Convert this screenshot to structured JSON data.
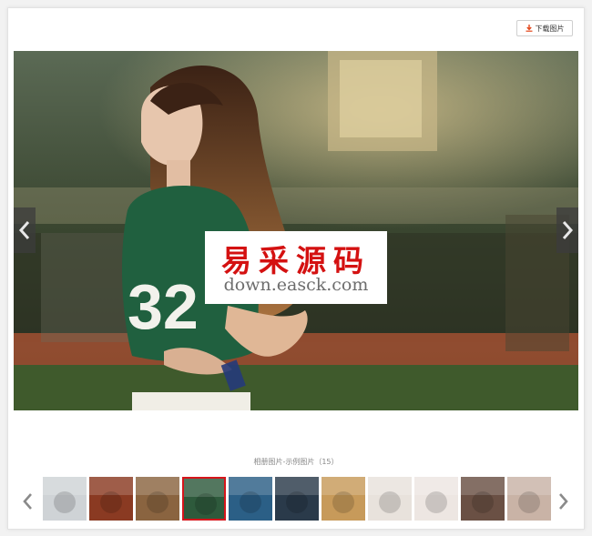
{
  "toolbar": {
    "download_label": "下载图片"
  },
  "watermark": {
    "title": "易采源码",
    "url": "down.easck.com"
  },
  "gallery": {
    "caption": "相册图片-示例图片（15）",
    "total": 15,
    "active_index": 3,
    "thumbnails": [
      {
        "name": "white-car",
        "color": "#cfd3d6"
      },
      {
        "name": "iron-man",
        "color": "#8a3a22"
      },
      {
        "name": "brown-texture",
        "color": "#8a6440"
      },
      {
        "name": "girl-green-shirt",
        "color": "#2e5a3c"
      },
      {
        "name": "blue-bottle",
        "color": "#2b5f86"
      },
      {
        "name": "dark-bag",
        "color": "#2a3a4a"
      },
      {
        "name": "gold-shoes",
        "color": "#c79a5a"
      },
      {
        "name": "white-portrait",
        "color": "#e8e2dc"
      },
      {
        "name": "pale-portrait",
        "color": "#ede6e2"
      },
      {
        "name": "dark-hair-girl",
        "color": "#6a5044"
      },
      {
        "name": "bangs-girl",
        "color": "#c9b3a6"
      }
    ]
  },
  "colors": {
    "accent": "#d6151b",
    "watermark_red": "#d41111"
  }
}
